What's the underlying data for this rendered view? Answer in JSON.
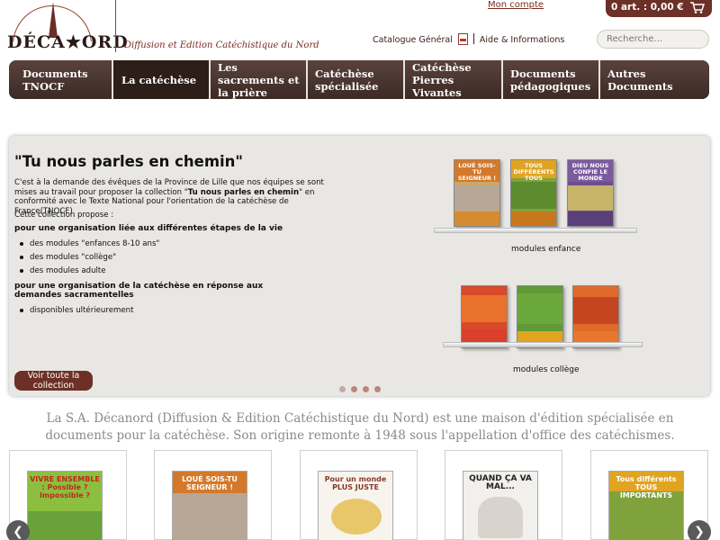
{
  "header": {
    "logo_text": "DÉCA★ORD",
    "tagline": "Diffusion et Edition Catéchistique du Nord",
    "account_link": "Mon compte",
    "cart_text": "0 art. : 0,00 €",
    "catalogue_link": "Catalogue Général",
    "help_link": "Aide & Informations",
    "search_placeholder": "Recherche..."
  },
  "nav": {
    "items": [
      {
        "label": "Documents TNOCF"
      },
      {
        "label": "La catéchèse"
      },
      {
        "label": "Les sacrements et la prière"
      },
      {
        "label": "Catéchèse spécialisée"
      },
      {
        "label": "Catéchèse Pierres Vivantes"
      },
      {
        "label": "Documents pédagogiques"
      },
      {
        "label": "Autres Documents"
      }
    ]
  },
  "slide": {
    "title": "\"Tu nous parles en chemin\"",
    "text_before": "C'est à la demande des évêques de la Province de Lille que nos équipes se sont mises au travail pour proposer la collection \"",
    "text_bold": "Tu nous parles en chemin",
    "text_after": "\" en conformité avec le Texte National pour l'orientation de la catéchèse de France(TNOCF)",
    "propose": "Cette collection propose :",
    "sub1": "pour une organisation liée aux différentes étapes de la vie",
    "list1": [
      "des modules \"enfances 8-10 ans\"",
      "des modules \"collège\"",
      "des modules adulte"
    ],
    "sub2": "pour une organisation de la catéchèse en réponse aux demandes sacramentelles",
    "list2": [
      "disponibles ultérieurement"
    ],
    "button": "Voir toute la collection",
    "shelf1_label": "modules enfance",
    "shelf2_label": "modules collège",
    "books_enfance": [
      "LOUÉ SOIS-TU SEIGNEUR !",
      "TOUS DIFFÉRENTS TOUS IMPORTANTS",
      "DIEU NOUS CONFIE LE MONDE"
    ]
  },
  "intro": "La S.A. Décanord (Diffusion & Edition Catéchistique du Nord) est une maison d'édition spécialisée en documents pour la catéchèse. Son origine remonte à 1948 sous l'appellation d'office des catéchismes.",
  "carousel": {
    "covers": [
      "VIVRE ENSEMBLE : Possible ? Impossible ?",
      "LOUÉ SOIS-TU SEIGNEUR !",
      "Pour un monde PLUS JUSTE",
      "QUAND ÇA VA MAL...",
      "Tous différents TOUS IMPORTANTS"
    ]
  },
  "colors": {
    "brand": "#6c3026",
    "nav_bg": "#4a3530",
    "intro_text": "#8a8a8a"
  }
}
